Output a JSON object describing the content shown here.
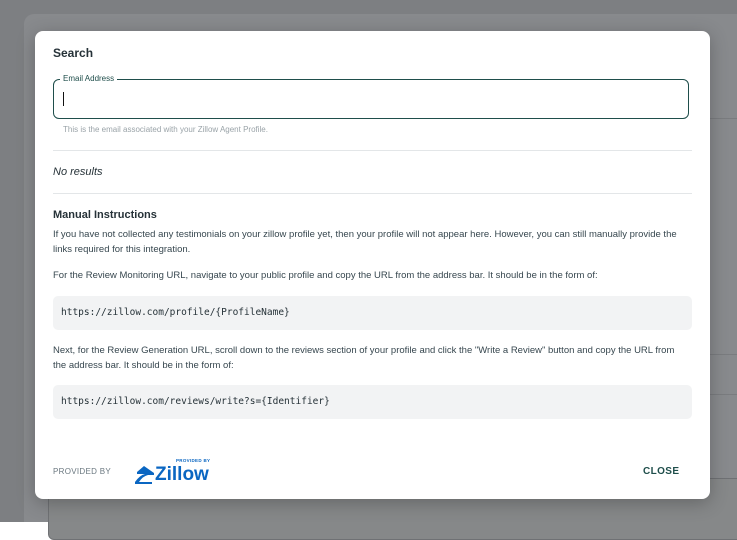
{
  "dialog": {
    "title": "Search",
    "email_field": {
      "label": "Email Address",
      "value": "",
      "helper": "This is the email associated with your Zillow Agent Profile."
    },
    "results_text": "No results",
    "manual": {
      "title": "Manual Instructions",
      "intro": "If you have not collected any testimonials on your zillow profile yet, then your profile will not appear here. However, you can still manually provide the links required for this integration.",
      "monitoring_text": "For the Review Monitoring URL, navigate to your public profile and copy the URL from the address bar. It should be in the form of:",
      "monitoring_url": "https://zillow.com/profile/{ProfileName}",
      "generation_text": "Next, for the Review Generation URL, scroll down to the reviews section of your profile and click the \"Write a Review\" button and copy the URL from the address bar. It should be in the form of:",
      "generation_url": "https://zillow.com/reviews/write?s={Identifier}"
    },
    "footer": {
      "provided_by": "PROVIDED BY",
      "logo_small_text": "PROVIDED BY",
      "logo_word": "Zillow",
      "logo_icon": "zillow-logo-icon",
      "close_label": "CLOSE"
    }
  },
  "colors": {
    "accent": "#1f4e4b",
    "zillow_blue": "#0a66c2",
    "backdrop": "#7d7f82"
  }
}
